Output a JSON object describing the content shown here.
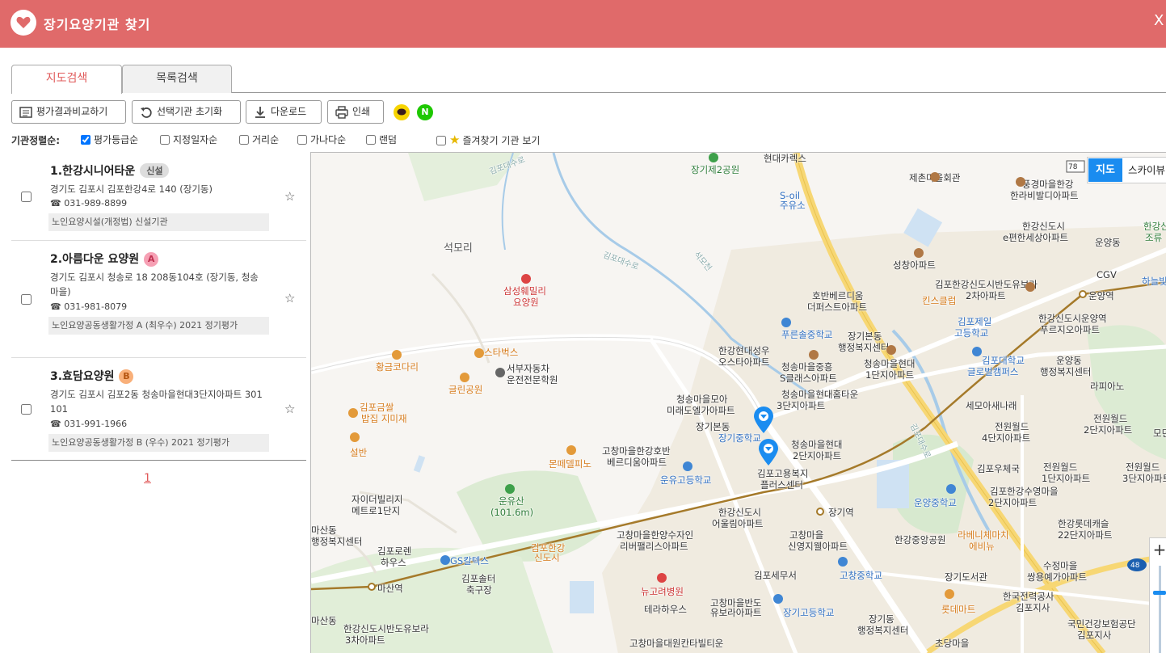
{
  "app": {
    "title": "장기요양기관 찾기",
    "close": "X"
  },
  "tabs": [
    {
      "label": "지도검색"
    },
    {
      "label": "목록검색"
    }
  ],
  "toolbar": {
    "compare": "평가결과비교하기",
    "reset": "선택기관 초기화",
    "download": "다운로드",
    "print": "인쇄",
    "kakao_icon": "kakao-talk-icon",
    "naver_icon": "N"
  },
  "sort": {
    "label": "기관정렬순:",
    "options": [
      {
        "label": "평가등급순",
        "checked": true
      },
      {
        "label": "지정일자순",
        "checked": false
      },
      {
        "label": "거리순",
        "checked": false
      },
      {
        "label": "가나다순",
        "checked": false
      },
      {
        "label": "랜덤",
        "checked": false
      },
      {
        "label": "즐겨찾기 기관 보기",
        "checked": false
      }
    ]
  },
  "results": [
    {
      "name": "1.한강시니어타운",
      "badge": "신설",
      "address": "경기도 김포시 김포한강4로 140 (장기동)",
      "phone": "☎ 031-989-8899",
      "tag": "노인요양시설(개정법) 신설기관"
    },
    {
      "name": "2.아름다운 요양원",
      "badge": "A",
      "address": "경기도 김포시 청송로 18 208동104호 (장기동, 청송마을)",
      "phone": "☎ 031-981-8079",
      "tag": "노인요양공동생활가정 A (최우수) 2021 정기평가"
    },
    {
      "name": "3.효담요양원",
      "badge": "B",
      "address": "경기도 김포시 김포2동 청송마을현대3단지아파트 301 101",
      "phone": "☎ 031-991-1966",
      "tag": "노인요양공동생활가정 B (우수) 2021 정기평가"
    }
  ],
  "pagination": {
    "current": "1"
  },
  "map": {
    "type_map": "지도",
    "type_sky": "스카이뷰",
    "zoom_in": "+",
    "labels": {
      "l1": "장기제2공원",
      "l2": "현대카렉스",
      "l3": "제촌마을회관",
      "l4": "풍경마을한강",
      "l5": "한라비발디아파트",
      "l6": "김포대수로",
      "l7": "S-oil",
      "l8": "주유소",
      "l9": "한강신도시",
      "l10": "e편한세상아파트",
      "l11": "석모리",
      "l12": "김포대수로",
      "l13": "성창아파트",
      "l14": "운양동",
      "l15": "CGV",
      "l16": "하늘빛중",
      "l17": "삼성훼밀리",
      "l18": "요양원",
      "l19": "호반베르디움",
      "l20": "더퍼스트아파트",
      "l21": "김포한강신도시반도유보라",
      "l22": "2차아파트",
      "l23": "운양역",
      "l24": "킨스클럽",
      "l25": "푸른솔중학교",
      "l26": "장기본동",
      "l27": "행정복지센터",
      "l28": "김포제일",
      "l29": "고등학교",
      "l30": "한강신도시운양역",
      "l31": "푸르지오아파트",
      "l32": "황금코다리",
      "l33": "스타벅스",
      "l34": "한강현대성우",
      "l35": "오스타아파트",
      "l36": "청송마을중흥",
      "l37": "S클래스아파트",
      "l38": "청송마을현대",
      "l39": "1단지아파트",
      "l40": "김포대학교",
      "l41": "글로벌캠퍼스",
      "l42": "운양동",
      "l43": "행정복지센터",
      "l44": "라피아노",
      "l45": "서부자동차",
      "l46": "운전전문학원",
      "l47": "글린공원",
      "l48": "청송마을모아",
      "l49": "미래도엘가아파트",
      "l50": "청송마을현대홈타운",
      "l51": "3단지아파트",
      "l52": "세모아새나래",
      "l53": "김포금쌀",
      "l54": "밥집 지미재",
      "l55": "장기본동",
      "l56": "장기중학교",
      "l57": "전원월드",
      "l58": "4단지아파트",
      "l59": "전원월드",
      "l60": "2단지아파트",
      "l61": "설반",
      "l62": "고창마을한강호반",
      "l63": "베르디움아파트",
      "l64": "몬떼델피노",
      "l65": "청송마을현대",
      "l66": "2단지아파트",
      "l67": "김포고용복지",
      "l68": "플러스센터",
      "l69": "운유고등학교",
      "l70": "김포우체국",
      "l71": "전원월드",
      "l72": "1단지아파트",
      "l73": "전원월드",
      "l74": "3단지아파트",
      "l75": "운유산",
      "l76": "(101.6m)",
      "l77": "자이더빌리지",
      "l78": "메트로1단지",
      "l79": "김포한강수영마을",
      "l80": "2단지아파트",
      "l81": "운양중학교",
      "l82": "장기역",
      "l83": "한강신도시",
      "l84": "어울림아파트",
      "l85": "마산동",
      "l86": "행정복지센터",
      "l87": "고창마을한양수자인",
      "l88": "리버팰리스아파트",
      "l89": "고창마을",
      "l90": "신영지웰아파트",
      "l91": "한강롯데캐슬",
      "l92": "22단지아파트",
      "l93": "김포한강",
      "l94": "신도시",
      "l95": "김포로렌",
      "l96": "하우스",
      "l97": "GS칼텍스",
      "l98": "한강중앙공원",
      "l99": "라베니체마치",
      "l100": "에비뉴",
      "l101": "마산역",
      "l102": "김포솔터",
      "l103": "축구장",
      "l104": "뉴고려병원",
      "l105": "김포세무서",
      "l106": "고창중학교",
      "l107": "장기도서관",
      "l108": "수정마을",
      "l109": "쌍용예가아파트",
      "l110": "테라하우스",
      "l111": "고창마을반도",
      "l112": "유보라아파트",
      "l113": "장기고등학교",
      "l114": "장기동",
      "l115": "행정복지센터",
      "l116": "롯데마트",
      "l117": "한국전력공사",
      "l118": "김포지사",
      "l119": "마산동",
      "l120": "한강신도시반도유보라",
      "l121": "3차아파트",
      "l122": "고창마을대원칸타빌티운",
      "l123": "초당마을",
      "l124": "국민건강보험공단",
      "l125": "김포지사",
      "l126": "78",
      "l127": "48",
      "l128": "김포대수로",
      "l129": "석모천",
      "l130": "김포대수로",
      "l131": "한강신도시",
      "l132": "조류",
      "l133": "모던",
      "l134": "쌍용예가아파트"
    }
  }
}
